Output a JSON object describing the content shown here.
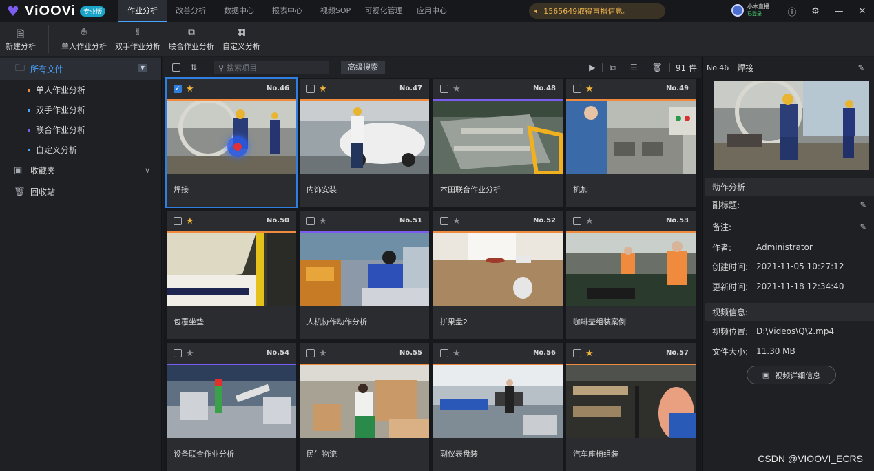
{
  "app": {
    "name": "ViOOVi",
    "edition": "专业版"
  },
  "top_tabs": [
    {
      "label": "作业分析",
      "active": true
    },
    {
      "label": "改善分析",
      "active": false
    },
    {
      "label": "数据中心",
      "active": false
    },
    {
      "label": "报表中心",
      "active": false
    },
    {
      "label": "视频SOP",
      "active": false
    },
    {
      "label": "可视化管理",
      "active": false
    },
    {
      "label": "应用中心",
      "active": false
    }
  ],
  "notice": "1565649取得直播信息。",
  "user": {
    "name": "小木直播",
    "status": "已登录"
  },
  "toolbar": [
    {
      "label": "新建分析",
      "icon": "new-file-icon"
    },
    {
      "label": "单人作业分析",
      "icon": "hand-icon"
    },
    {
      "label": "双手作业分析",
      "icon": "two-hands-icon"
    },
    {
      "label": "联合作业分析",
      "icon": "joint-icon"
    },
    {
      "label": "自定义分析",
      "icon": "custom-grid-icon"
    }
  ],
  "sidebar": {
    "root": "所有文件",
    "children": [
      "单人作业分析",
      "双手作业分析",
      "联合作业分析",
      "自定义分析"
    ],
    "child_colors": [
      "#f08a3c",
      "#4aa3ff",
      "#7b5cf0",
      "#4aa3ff"
    ],
    "favorites": "收藏夹",
    "trash": "回收站"
  },
  "grid": {
    "search_placeholder": "搜索项目",
    "advanced_search": "高级搜索",
    "count": "91",
    "count_unit": "件"
  },
  "cards": [
    {
      "no": "No.46",
      "title": "焊接",
      "starred": true,
      "checked": true,
      "accent": "#f08a3c",
      "thumb": "weld",
      "selected": true
    },
    {
      "no": "No.47",
      "title": "内饰安装",
      "starred": true,
      "checked": false,
      "accent": "#f08a3c",
      "thumb": "car"
    },
    {
      "no": "No.48",
      "title": "本田联合作业分析",
      "starred": false,
      "checked": false,
      "accent": "#7b5cf0",
      "thumb": "frame"
    },
    {
      "no": "No.49",
      "title": "机加",
      "starred": true,
      "checked": false,
      "accent": "#f08a3c",
      "thumb": "machine"
    },
    {
      "no": "No.50",
      "title": "包覆坐垫",
      "starred": true,
      "checked": false,
      "accent": "#f08a3c",
      "thumb": "seat"
    },
    {
      "no": "No.51",
      "title": "人机协作动作分析",
      "starred": false,
      "checked": false,
      "accent": "#7b5cf0",
      "thumb": "cobot"
    },
    {
      "no": "No.52",
      "title": "拼果盘2",
      "starred": false,
      "checked": false,
      "accent": "#f08a3c",
      "thumb": "fruit"
    },
    {
      "no": "No.53",
      "title": "咖啡壶组装案例",
      "starred": false,
      "checked": false,
      "accent": "#f08a3c",
      "thumb": "coffee"
    },
    {
      "no": "No.54",
      "title": "设备联合作业分析",
      "starred": false,
      "checked": false,
      "accent": "#7b5cf0",
      "thumb": "robot"
    },
    {
      "no": "No.55",
      "title": "民生物流",
      "starred": false,
      "checked": false,
      "accent": "#f08a3c",
      "thumb": "boxes"
    },
    {
      "no": "No.56",
      "title": "副仪表盘装",
      "starred": false,
      "checked": false,
      "accent": "#f08a3c",
      "thumb": "line"
    },
    {
      "no": "No.57",
      "title": "汽车座椅组装",
      "starred": true,
      "checked": false,
      "accent": "#f08a3c",
      "thumb": "seat2"
    }
  ],
  "panel": {
    "no": "No.46",
    "title": "焊接",
    "section_action": "动作分析",
    "subtitle_label": "副标题:",
    "note_label": "备注:",
    "author_label": "作者:",
    "author": "Administrator",
    "created_label": "创建时间:",
    "created": "2021-11-05 10:27:12",
    "updated_label": "更新时间:",
    "updated": "2021-11-18 12:34:40",
    "section_video": "视频信息:",
    "path_label": "视频位置:",
    "path": "D:\\Videos\\Q\\2.mp4",
    "size_label": "文件大小:",
    "size": "11.30 MB",
    "detail_button": "视频详细信息"
  },
  "watermark": "CSDN @VIOOVI_ECRS"
}
